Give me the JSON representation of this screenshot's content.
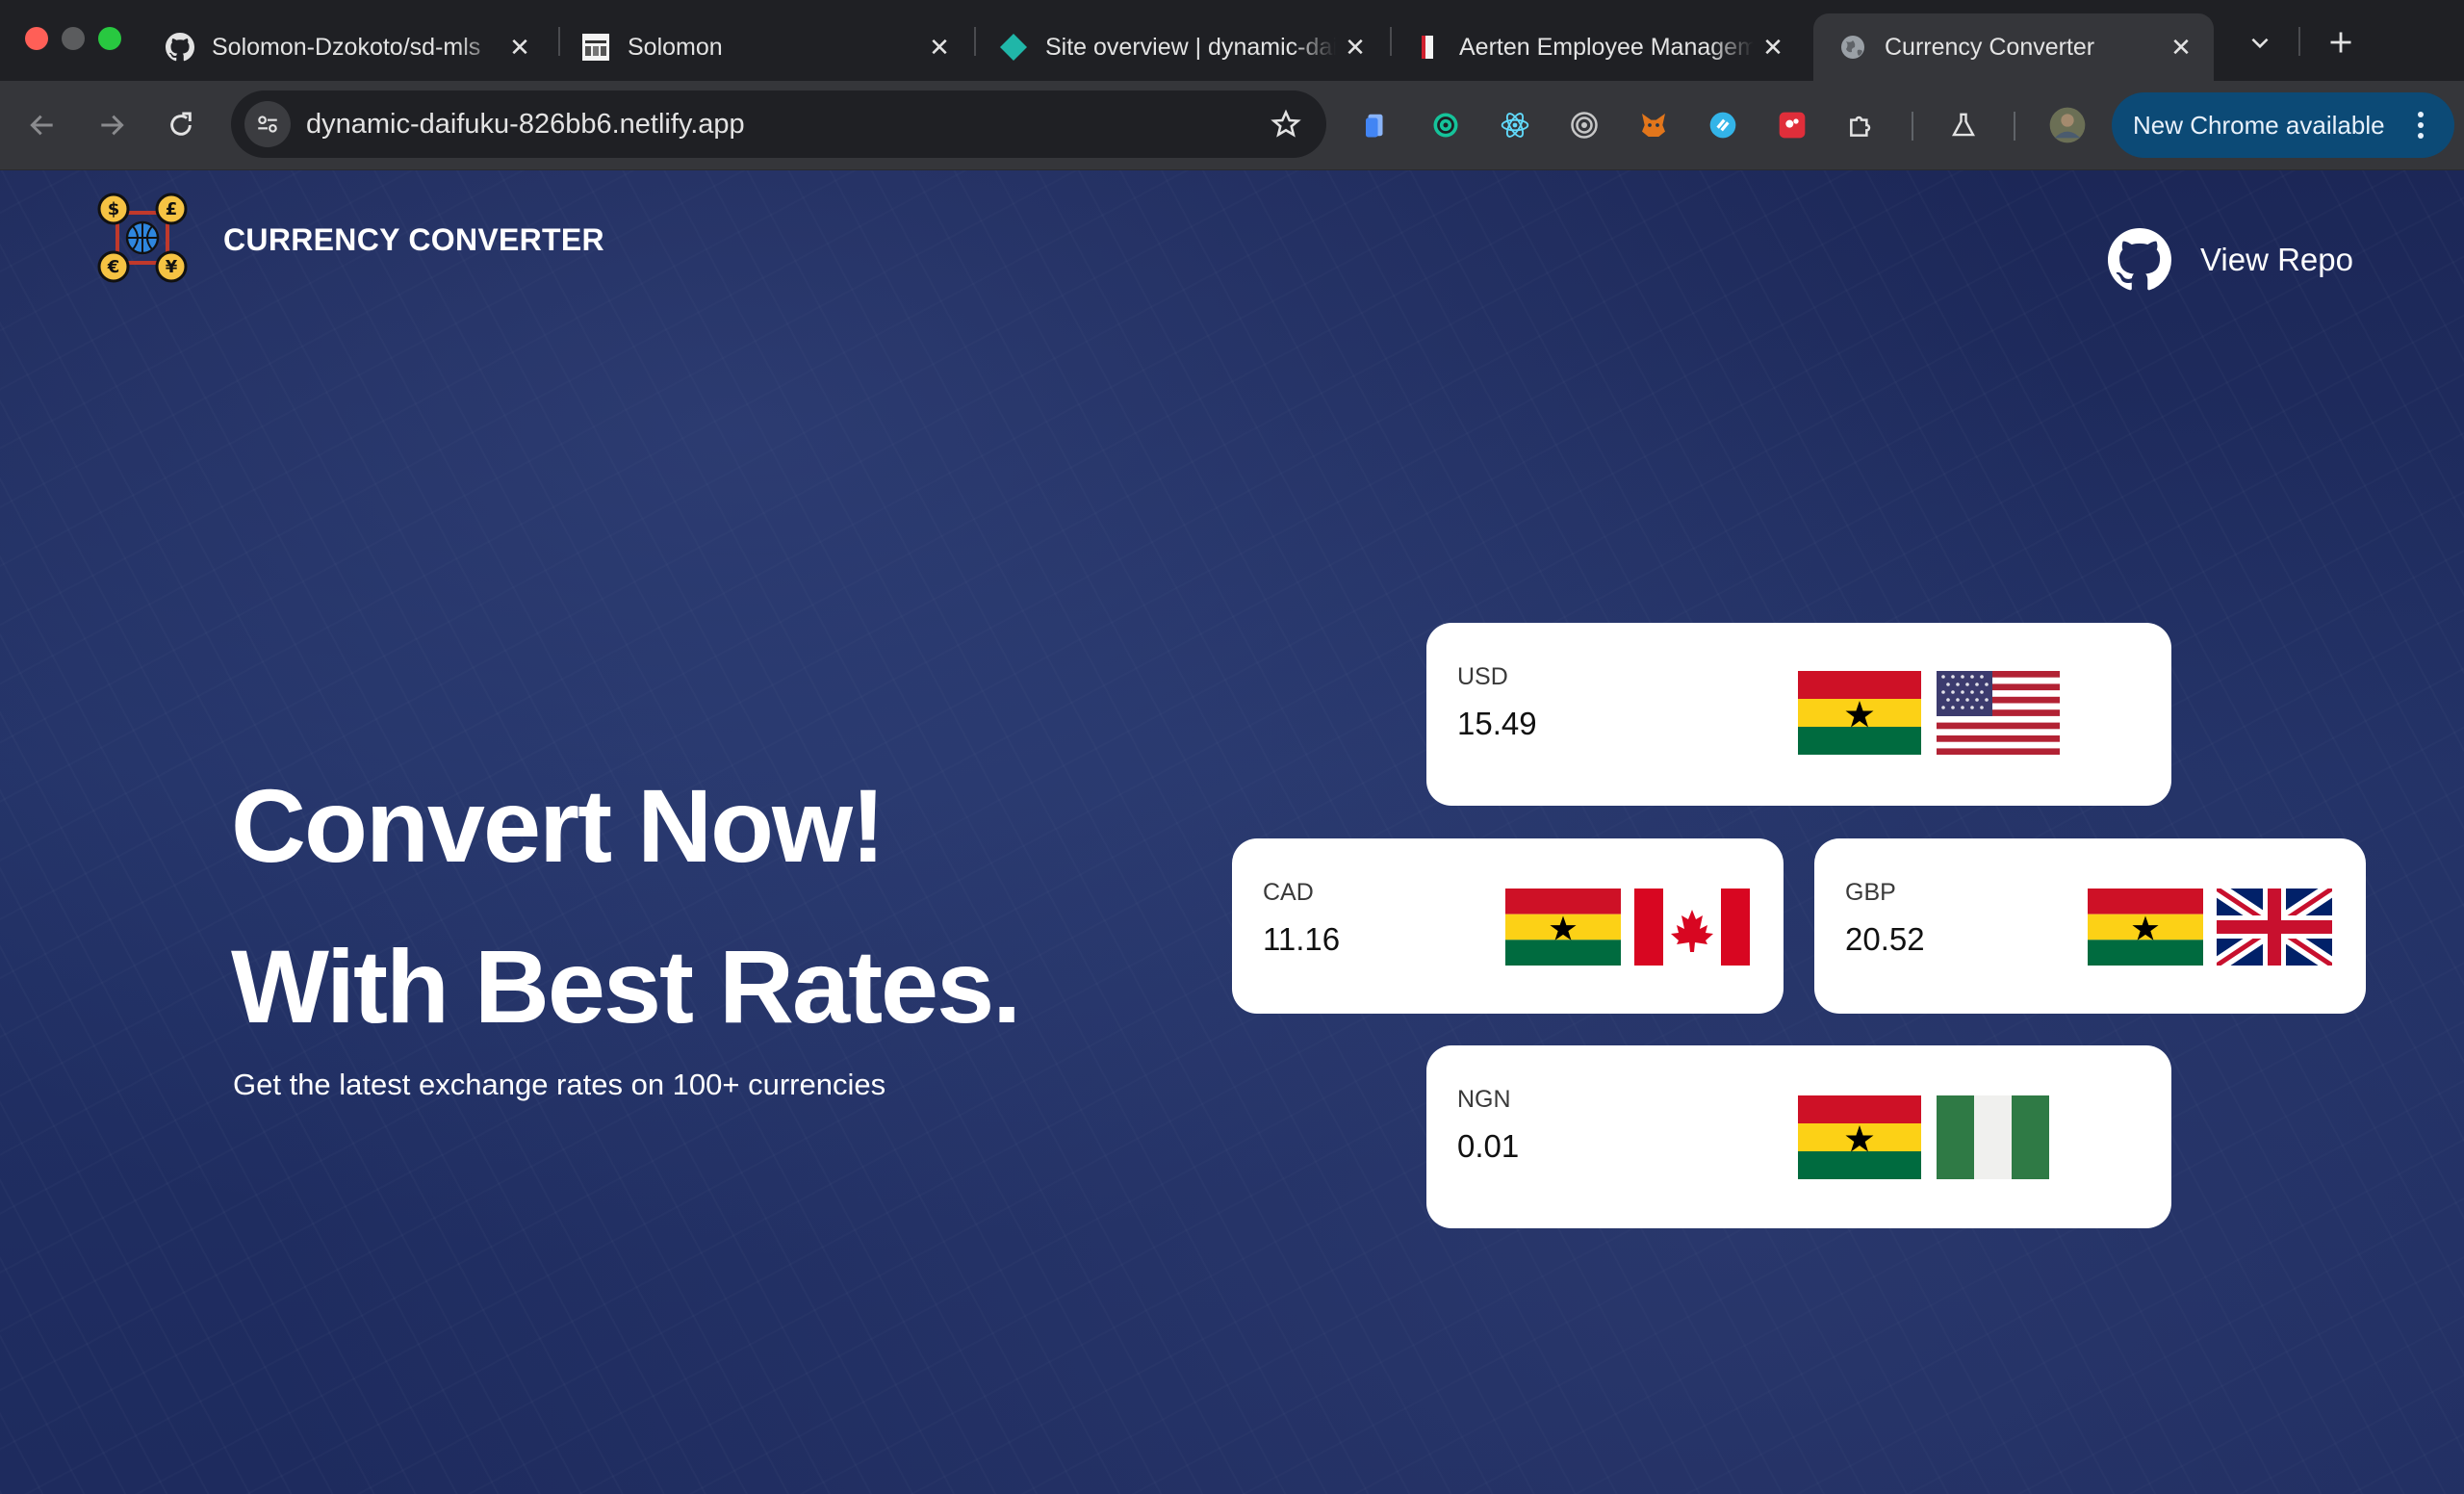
{
  "browser": {
    "tabs": [
      {
        "title": "Solomon-Dzokoto/sd-mls",
        "favicon": "github-icon",
        "active": false
      },
      {
        "title": "Solomon",
        "favicon": "newsprint-icon",
        "active": false
      },
      {
        "title": "Site overview | dynamic-daifuku",
        "favicon": "netlify-diamond-icon",
        "active": false
      },
      {
        "title": "Aerten Employee Management",
        "favicon": "red-page-icon",
        "active": false
      },
      {
        "title": "Currency Converter",
        "favicon": "globe-icon",
        "active": true
      }
    ],
    "url": "dynamic-daifuku-826bb6.netlify.app",
    "update_button": "New Chrome available",
    "colors": {
      "accent": "#0c4a76",
      "tab_active": "#35363a",
      "tab_strip": "#1f2024"
    }
  },
  "site": {
    "brand_title": "CURRENCY CONVERTER",
    "repo_link": "View Repo",
    "hero_line1": "Convert Now!",
    "hero_line2": "With Best Rates.",
    "hero_subtitle": "Get the latest exchange rates on 100+ currencies",
    "colors": {
      "background": "#213064",
      "card": "#ffffff"
    },
    "rates": [
      {
        "code": "USD",
        "value": "15.49",
        "flags": [
          "ghana-flag-icon",
          "usa-flag-icon"
        ]
      },
      {
        "code": "CAD",
        "value": "11.16",
        "flags": [
          "ghana-flag-icon",
          "canada-flag-icon"
        ]
      },
      {
        "code": "GBP",
        "value": "20.52",
        "flags": [
          "ghana-flag-icon",
          "uk-flag-icon"
        ]
      },
      {
        "code": "NGN",
        "value": "0.01",
        "flags": [
          "ghana-flag-icon",
          "nigeria-flag-icon"
        ]
      }
    ]
  }
}
